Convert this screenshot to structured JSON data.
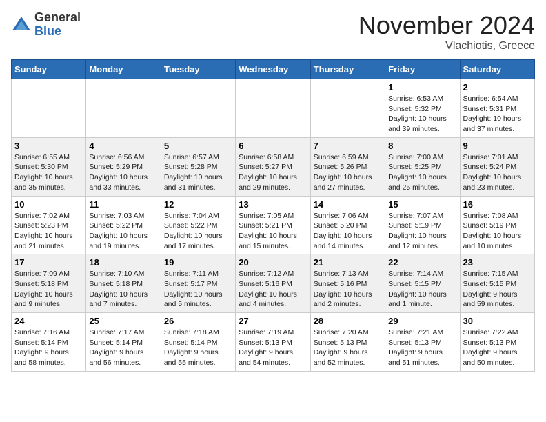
{
  "header": {
    "logo_general": "General",
    "logo_blue": "Blue",
    "month_title": "November 2024",
    "location": "Vlachiotis, Greece"
  },
  "weekdays": [
    "Sunday",
    "Monday",
    "Tuesday",
    "Wednesday",
    "Thursday",
    "Friday",
    "Saturday"
  ],
  "weeks": [
    [
      {
        "day": "",
        "info": ""
      },
      {
        "day": "",
        "info": ""
      },
      {
        "day": "",
        "info": ""
      },
      {
        "day": "",
        "info": ""
      },
      {
        "day": "",
        "info": ""
      },
      {
        "day": "1",
        "info": "Sunrise: 6:53 AM\nSunset: 5:32 PM\nDaylight: 10 hours\nand 39 minutes."
      },
      {
        "day": "2",
        "info": "Sunrise: 6:54 AM\nSunset: 5:31 PM\nDaylight: 10 hours\nand 37 minutes."
      }
    ],
    [
      {
        "day": "3",
        "info": "Sunrise: 6:55 AM\nSunset: 5:30 PM\nDaylight: 10 hours\nand 35 minutes."
      },
      {
        "day": "4",
        "info": "Sunrise: 6:56 AM\nSunset: 5:29 PM\nDaylight: 10 hours\nand 33 minutes."
      },
      {
        "day": "5",
        "info": "Sunrise: 6:57 AM\nSunset: 5:28 PM\nDaylight: 10 hours\nand 31 minutes."
      },
      {
        "day": "6",
        "info": "Sunrise: 6:58 AM\nSunset: 5:27 PM\nDaylight: 10 hours\nand 29 minutes."
      },
      {
        "day": "7",
        "info": "Sunrise: 6:59 AM\nSunset: 5:26 PM\nDaylight: 10 hours\nand 27 minutes."
      },
      {
        "day": "8",
        "info": "Sunrise: 7:00 AM\nSunset: 5:25 PM\nDaylight: 10 hours\nand 25 minutes."
      },
      {
        "day": "9",
        "info": "Sunrise: 7:01 AM\nSunset: 5:24 PM\nDaylight: 10 hours\nand 23 minutes."
      }
    ],
    [
      {
        "day": "10",
        "info": "Sunrise: 7:02 AM\nSunset: 5:23 PM\nDaylight: 10 hours\nand 21 minutes."
      },
      {
        "day": "11",
        "info": "Sunrise: 7:03 AM\nSunset: 5:22 PM\nDaylight: 10 hours\nand 19 minutes."
      },
      {
        "day": "12",
        "info": "Sunrise: 7:04 AM\nSunset: 5:22 PM\nDaylight: 10 hours\nand 17 minutes."
      },
      {
        "day": "13",
        "info": "Sunrise: 7:05 AM\nSunset: 5:21 PM\nDaylight: 10 hours\nand 15 minutes."
      },
      {
        "day": "14",
        "info": "Sunrise: 7:06 AM\nSunset: 5:20 PM\nDaylight: 10 hours\nand 14 minutes."
      },
      {
        "day": "15",
        "info": "Sunrise: 7:07 AM\nSunset: 5:19 PM\nDaylight: 10 hours\nand 12 minutes."
      },
      {
        "day": "16",
        "info": "Sunrise: 7:08 AM\nSunset: 5:19 PM\nDaylight: 10 hours\nand 10 minutes."
      }
    ],
    [
      {
        "day": "17",
        "info": "Sunrise: 7:09 AM\nSunset: 5:18 PM\nDaylight: 10 hours\nand 9 minutes."
      },
      {
        "day": "18",
        "info": "Sunrise: 7:10 AM\nSunset: 5:18 PM\nDaylight: 10 hours\nand 7 minutes."
      },
      {
        "day": "19",
        "info": "Sunrise: 7:11 AM\nSunset: 5:17 PM\nDaylight: 10 hours\nand 5 minutes."
      },
      {
        "day": "20",
        "info": "Sunrise: 7:12 AM\nSunset: 5:16 PM\nDaylight: 10 hours\nand 4 minutes."
      },
      {
        "day": "21",
        "info": "Sunrise: 7:13 AM\nSunset: 5:16 PM\nDaylight: 10 hours\nand 2 minutes."
      },
      {
        "day": "22",
        "info": "Sunrise: 7:14 AM\nSunset: 5:15 PM\nDaylight: 10 hours\nand 1 minute."
      },
      {
        "day": "23",
        "info": "Sunrise: 7:15 AM\nSunset: 5:15 PM\nDaylight: 9 hours\nand 59 minutes."
      }
    ],
    [
      {
        "day": "24",
        "info": "Sunrise: 7:16 AM\nSunset: 5:14 PM\nDaylight: 9 hours\nand 58 minutes."
      },
      {
        "day": "25",
        "info": "Sunrise: 7:17 AM\nSunset: 5:14 PM\nDaylight: 9 hours\nand 56 minutes."
      },
      {
        "day": "26",
        "info": "Sunrise: 7:18 AM\nSunset: 5:14 PM\nDaylight: 9 hours\nand 55 minutes."
      },
      {
        "day": "27",
        "info": "Sunrise: 7:19 AM\nSunset: 5:13 PM\nDaylight: 9 hours\nand 54 minutes."
      },
      {
        "day": "28",
        "info": "Sunrise: 7:20 AM\nSunset: 5:13 PM\nDaylight: 9 hours\nand 52 minutes."
      },
      {
        "day": "29",
        "info": "Sunrise: 7:21 AM\nSunset: 5:13 PM\nDaylight: 9 hours\nand 51 minutes."
      },
      {
        "day": "30",
        "info": "Sunrise: 7:22 AM\nSunset: 5:13 PM\nDaylight: 9 hours\nand 50 minutes."
      }
    ]
  ]
}
